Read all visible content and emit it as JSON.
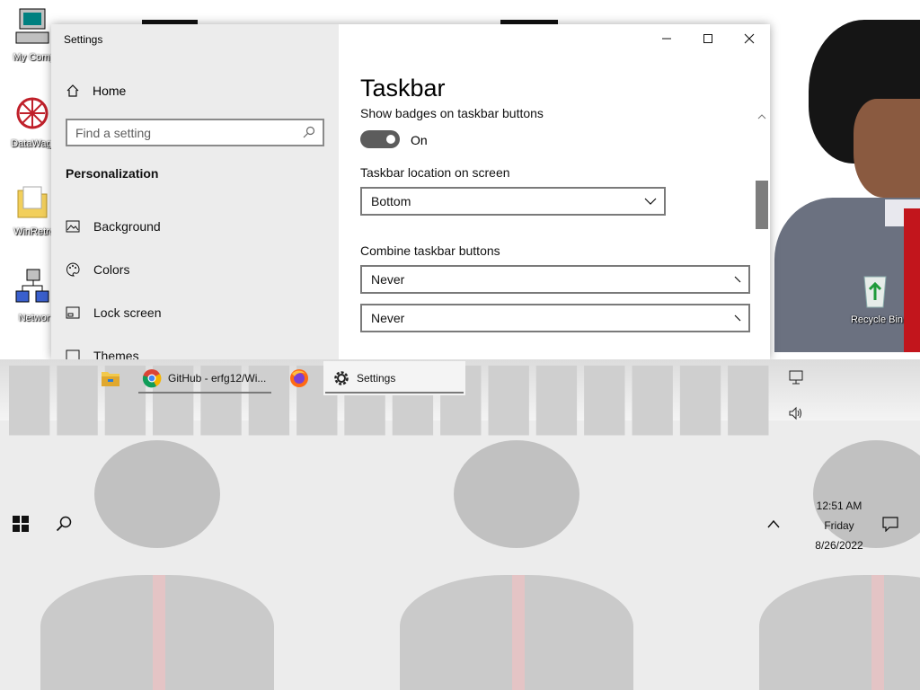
{
  "desktop": {
    "icons": [
      {
        "label": "My Comp",
        "icon": "computer-icon"
      },
      {
        "label": "DataWago",
        "icon": "datawagon-icon"
      },
      {
        "label": "WinRetro",
        "icon": "folder-icon"
      },
      {
        "label": "Networ",
        "icon": "network-icon"
      }
    ],
    "recycle_bin": "Recycle Bin"
  },
  "window": {
    "title": "Settings",
    "home": "Home",
    "search_placeholder": "Find a setting",
    "section": "Personalization",
    "nav": [
      {
        "label": "Background",
        "icon": "image-icon"
      },
      {
        "label": "Colors",
        "icon": "palette-icon"
      },
      {
        "label": "Lock screen",
        "icon": "lock-screen-icon"
      },
      {
        "label": "Themes",
        "icon": "themes-icon"
      }
    ],
    "content": {
      "title": "Taskbar",
      "badges_label": "Show badges on taskbar buttons",
      "badges_state": "On",
      "location_label": "Taskbar location on screen",
      "location_value": "Bottom",
      "combine_label": "Combine taskbar buttons",
      "combine_value": "Never",
      "combine_other_value": "Never"
    }
  },
  "taskbar": {
    "apps": [
      {
        "label": "",
        "icon": "file-explorer-icon"
      },
      {
        "label": "GitHub - erfg12/Wi...",
        "icon": "chrome-icon"
      },
      {
        "label": "",
        "icon": "firefox-icon"
      },
      {
        "label": "Settings",
        "icon": "gear-icon"
      }
    ],
    "clock": {
      "time": "12:51 AM",
      "day": "Friday",
      "date": "8/26/2022"
    }
  },
  "colors": {
    "toggle_on": "#5c5c5c",
    "accent": "#0078d7"
  }
}
